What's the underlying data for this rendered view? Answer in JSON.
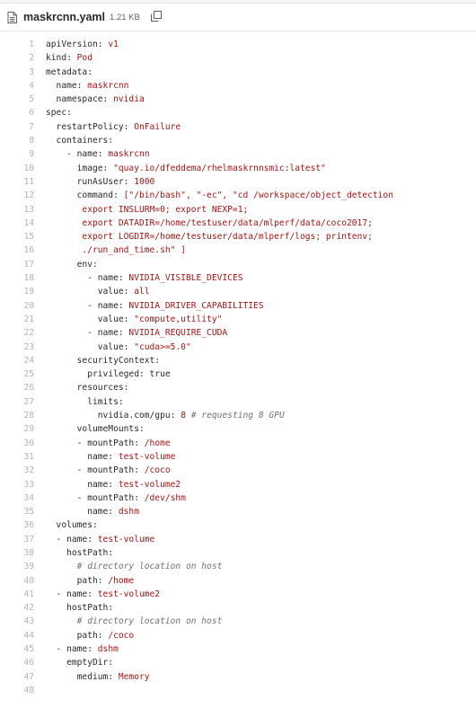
{
  "file": {
    "name": "maskrcnn.yaml",
    "size": "1.21 KB"
  },
  "icons": [
    "file-icon",
    "copy-icon"
  ],
  "colors": {
    "key": "#24292e",
    "string": "#a31515",
    "comment": "#6a737d",
    "line_number": "#b0b3b8"
  },
  "lines": [
    [
      {
        "t": "apiVersion: ",
        "c": "key"
      },
      {
        "t": "v1",
        "c": "val"
      }
    ],
    [
      {
        "t": "kind: ",
        "c": "key"
      },
      {
        "t": "Pod",
        "c": "val"
      }
    ],
    [
      {
        "t": "metadata:",
        "c": "key"
      }
    ],
    [
      {
        "t": "  name: ",
        "c": "key"
      },
      {
        "t": "maskrcnn",
        "c": "val"
      }
    ],
    [
      {
        "t": "  namespace: ",
        "c": "key"
      },
      {
        "t": "nvidia",
        "c": "val"
      }
    ],
    [
      {
        "t": "spec:",
        "c": "key"
      }
    ],
    [
      {
        "t": "  restartPolicy: ",
        "c": "key"
      },
      {
        "t": "OnFailure",
        "c": "val"
      }
    ],
    [
      {
        "t": "  containers:",
        "c": "key"
      }
    ],
    [
      {
        "t": "    - name: ",
        "c": "key"
      },
      {
        "t": "maskrcnn",
        "c": "val"
      }
    ],
    [
      {
        "t": "      image: ",
        "c": "key"
      },
      {
        "t": "\"quay.io/dfeddema/rhelmaskrnnsmic:latest\"",
        "c": "str"
      }
    ],
    [
      {
        "t": "      runAsUser: ",
        "c": "key"
      },
      {
        "t": "1000",
        "c": "num"
      }
    ],
    [
      {
        "t": "      command: ",
        "c": "key"
      },
      {
        "t": "[\"/bin/bash\", \"-ec\", \"cd /workspace/object_detection",
        "c": "str"
      }
    ],
    [
      {
        "t": "       export INSLURM=0; export NEXP=1;",
        "c": "str"
      }
    ],
    [
      {
        "t": "       export DATADIR=/home/testuser/data/mlperf/data/coco2017;",
        "c": "str"
      }
    ],
    [
      {
        "t": "       export LOGDIR=/home/testuser/data/mlperf/logs; printenv;",
        "c": "str"
      }
    ],
    [
      {
        "t": "       ./run_and_time.sh\" ]",
        "c": "str"
      }
    ],
    [
      {
        "t": "      env:",
        "c": "key"
      }
    ],
    [
      {
        "t": "        - name: ",
        "c": "key"
      },
      {
        "t": "NVIDIA_VISIBLE_DEVICES",
        "c": "val"
      }
    ],
    [
      {
        "t": "          value: ",
        "c": "key"
      },
      {
        "t": "all",
        "c": "val"
      }
    ],
    [
      {
        "t": "        - name: ",
        "c": "key"
      },
      {
        "t": "NVIDIA_DRIVER_CAPABILITIES",
        "c": "val"
      }
    ],
    [
      {
        "t": "          value: ",
        "c": "key"
      },
      {
        "t": "\"compute,utility\"",
        "c": "str"
      }
    ],
    [
      {
        "t": "        - name: ",
        "c": "key"
      },
      {
        "t": "NVIDIA_REQUIRE_CUDA",
        "c": "val"
      }
    ],
    [
      {
        "t": "          value: ",
        "c": "key"
      },
      {
        "t": "\"cuda>=5.0\"",
        "c": "str"
      }
    ],
    [
      {
        "t": "      securityContext:",
        "c": "key"
      }
    ],
    [
      {
        "t": "        privileged: ",
        "c": "key"
      },
      {
        "t": "true",
        "c": "bool"
      }
    ],
    [
      {
        "t": "      resources:",
        "c": "key"
      }
    ],
    [
      {
        "t": "        limits:",
        "c": "key"
      }
    ],
    [
      {
        "t": "          nvidia.com/gpu: ",
        "c": "key"
      },
      {
        "t": "8",
        "c": "num"
      },
      {
        "t": " ",
        "c": "plain"
      },
      {
        "t": "# requesting 8 GPU",
        "c": "cmt"
      }
    ],
    [
      {
        "t": "      volumeMounts:",
        "c": "key"
      }
    ],
    [
      {
        "t": "      - mountPath: ",
        "c": "key"
      },
      {
        "t": "/home",
        "c": "val"
      }
    ],
    [
      {
        "t": "        name: ",
        "c": "key"
      },
      {
        "t": "test-volume",
        "c": "val"
      }
    ],
    [
      {
        "t": "      - mountPath: ",
        "c": "key"
      },
      {
        "t": "/coco",
        "c": "val"
      }
    ],
    [
      {
        "t": "        name: ",
        "c": "key"
      },
      {
        "t": "test-volume2",
        "c": "val"
      }
    ],
    [
      {
        "t": "      - mountPath: ",
        "c": "key"
      },
      {
        "t": "/dev/shm",
        "c": "val"
      }
    ],
    [
      {
        "t": "        name: ",
        "c": "key"
      },
      {
        "t": "dshm",
        "c": "val"
      }
    ],
    [
      {
        "t": "  volumes:",
        "c": "key"
      }
    ],
    [
      {
        "t": "  - name: ",
        "c": "key"
      },
      {
        "t": "test-volume",
        "c": "val"
      }
    ],
    [
      {
        "t": "    hostPath:",
        "c": "key"
      }
    ],
    [
      {
        "t": "      ",
        "c": "plain"
      },
      {
        "t": "# directory location on host",
        "c": "cmt"
      }
    ],
    [
      {
        "t": "      path: ",
        "c": "key"
      },
      {
        "t": "/home",
        "c": "val"
      }
    ],
    [
      {
        "t": "  - name: ",
        "c": "key"
      },
      {
        "t": "test-volume2",
        "c": "val"
      }
    ],
    [
      {
        "t": "    hostPath:",
        "c": "key"
      }
    ],
    [
      {
        "t": "      ",
        "c": "plain"
      },
      {
        "t": "# directory location on host",
        "c": "cmt"
      }
    ],
    [
      {
        "t": "      path: ",
        "c": "key"
      },
      {
        "t": "/coco",
        "c": "val"
      }
    ],
    [
      {
        "t": "  - name: ",
        "c": "key"
      },
      {
        "t": "dshm",
        "c": "val"
      }
    ],
    [
      {
        "t": "    emptyDir:",
        "c": "key"
      }
    ],
    [
      {
        "t": "      medium: ",
        "c": "key"
      },
      {
        "t": "Memory",
        "c": "val"
      }
    ],
    []
  ]
}
